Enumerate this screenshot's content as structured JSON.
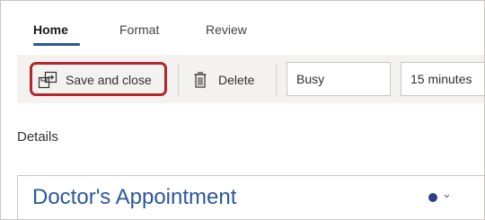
{
  "tabs": [
    {
      "label": "Home",
      "active": true
    },
    {
      "label": "Format",
      "active": false
    },
    {
      "label": "Review",
      "active": false
    }
  ],
  "toolbar": {
    "save_label": "Save and close",
    "delete_label": "Delete",
    "show_as_value": "Busy",
    "reminder_value": "15 minutes"
  },
  "details": {
    "heading": "Details",
    "title": "Doctor's Appointment"
  },
  "colors": {
    "accent": "#2b579a",
    "highlight": "#b3262a",
    "category_dot": "#2f3f85"
  },
  "icons": [
    "save-close-icon",
    "trash-icon",
    "chevron-down-icon"
  ]
}
